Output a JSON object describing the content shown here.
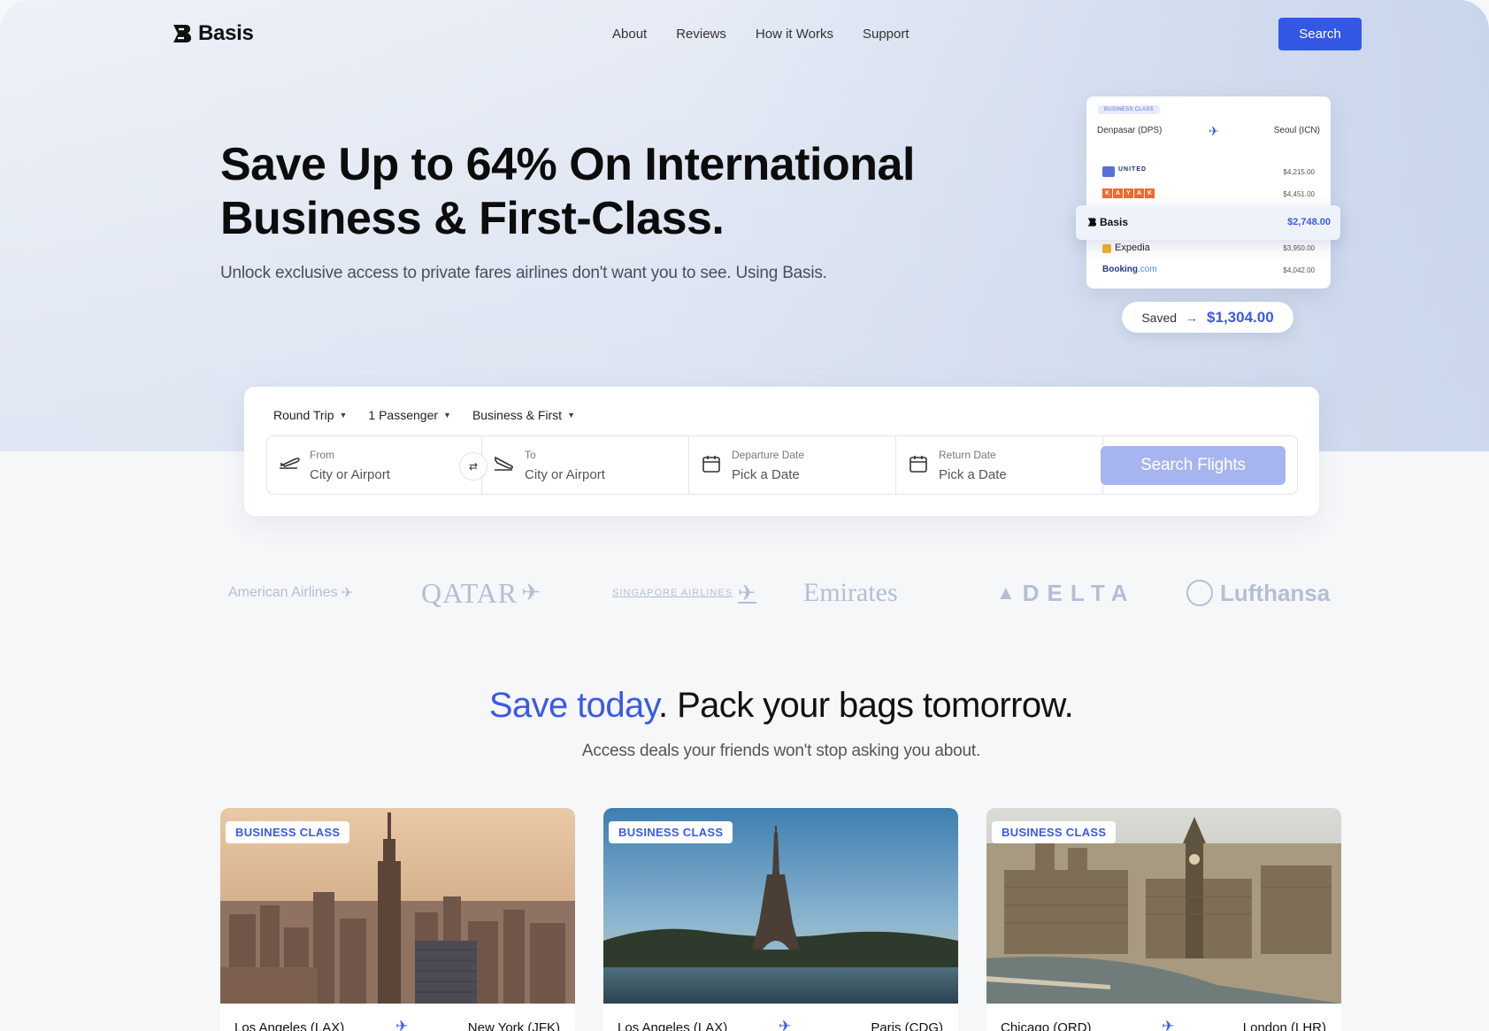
{
  "brand": {
    "name": "Basis",
    "accent": "#3a5ae6"
  },
  "nav": {
    "links": [
      "About",
      "Reviews",
      "How it Works",
      "Support"
    ],
    "search_label": "Search"
  },
  "hero": {
    "title_line1": "Save Up to 64% On International",
    "title_line2": "Business & First-Class.",
    "subtitle": "Unlock exclusive access to private fares airlines don't want you to see. Using Basis."
  },
  "compare": {
    "badge": "BUSINESS CLASS",
    "from": "Denpasar (DPS)",
    "to": "Seoul (ICN)",
    "rows": [
      {
        "brand": "UNITED",
        "price": "$4,215.00"
      },
      {
        "brand": "KAYAK",
        "price": "$4,451.00"
      },
      {
        "brand": "Basis",
        "price": "$2,748.00"
      },
      {
        "brand": "Expedia",
        "price": "$3,950.00"
      },
      {
        "brand_main": "Booking",
        "brand_suffix": ".com",
        "price": "$4,042.00"
      }
    ],
    "saved_label": "Saved",
    "saved_amount": "$1,304.00"
  },
  "search": {
    "trip_type": "Round Trip",
    "passengers": "1 Passenger",
    "cabin": "Business & First",
    "from_label": "From",
    "from_placeholder": "City or Airport",
    "to_label": "To",
    "to_placeholder": "City or Airport",
    "depart_label": "Departure Date",
    "depart_placeholder": "Pick a Date",
    "return_label": "Return Date",
    "return_placeholder": "Pick a Date",
    "button": "Search Flights"
  },
  "airlines": [
    "American Airlines",
    "QATAR",
    "SINGAPORE AIRLINES",
    "Emirates",
    "DELTA",
    "Lufthansa"
  ],
  "deals": {
    "title_accent": "Save today",
    "title_rest": ". Pack your bags tomorrow.",
    "subtitle": "Access deals your friends won't stop asking you about.",
    "cards": [
      {
        "badge": "BUSINESS CLASS",
        "from": "Los Angeles (LAX)",
        "to": "New York (JFK)"
      },
      {
        "badge": "BUSINESS CLASS",
        "from": "Los Angeles (LAX)",
        "to": "Paris (CDG)"
      },
      {
        "badge": "BUSINESS CLASS",
        "from": "Chicago (ORD)",
        "to": "London (LHR)"
      }
    ]
  }
}
